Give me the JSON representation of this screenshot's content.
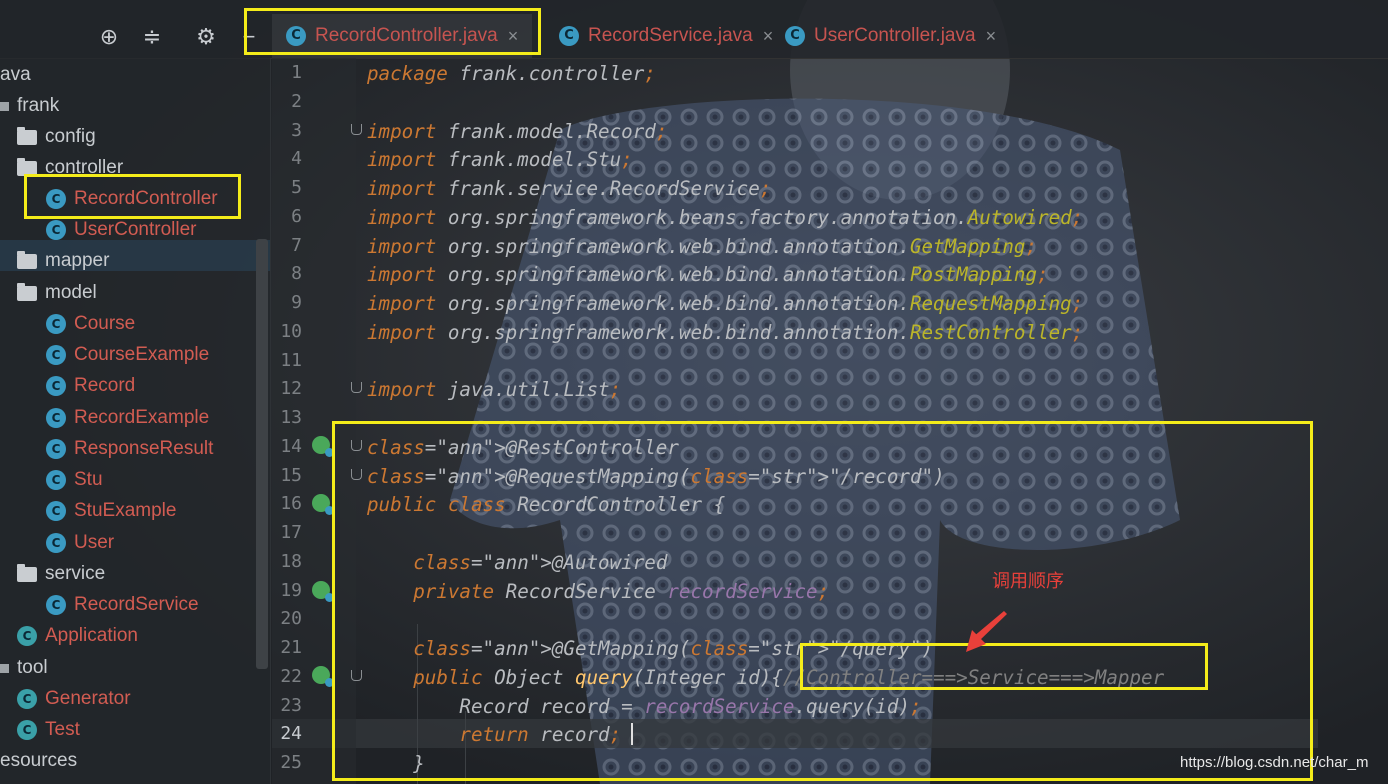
{
  "toolbar": {
    "icons": [
      "crosshair-icon",
      "collapse-icon",
      "gear-icon",
      "minimize-icon"
    ]
  },
  "tabs": [
    {
      "label": "RecordController.java",
      "icon": "class-icon",
      "active": true,
      "close": "×"
    },
    {
      "label": "RecordService.java",
      "icon": "class-icon",
      "active": false,
      "close": "×"
    },
    {
      "label": "UserController.java",
      "icon": "class-icon",
      "active": false,
      "close": "×"
    }
  ],
  "tree": {
    "items": [
      {
        "label": "ava",
        "kind": "root"
      },
      {
        "label": "frank",
        "kind": "package"
      },
      {
        "label": "config",
        "kind": "folder"
      },
      {
        "label": "controller",
        "kind": "folder"
      },
      {
        "label": "RecordController",
        "kind": "class",
        "selected": true
      },
      {
        "label": "UserController",
        "kind": "class"
      },
      {
        "label": "mapper",
        "kind": "folder"
      },
      {
        "label": "model",
        "kind": "folder"
      },
      {
        "label": "Course",
        "kind": "class"
      },
      {
        "label": "CourseExample",
        "kind": "class"
      },
      {
        "label": "Record",
        "kind": "class"
      },
      {
        "label": "RecordExample",
        "kind": "class"
      },
      {
        "label": "ResponseResult",
        "kind": "class"
      },
      {
        "label": "Stu",
        "kind": "class"
      },
      {
        "label": "StuExample",
        "kind": "class"
      },
      {
        "label": "User",
        "kind": "class"
      },
      {
        "label": "service",
        "kind": "folder"
      },
      {
        "label": "RecordService",
        "kind": "class"
      },
      {
        "label": "Application",
        "kind": "runclass"
      },
      {
        "label": "tool",
        "kind": "package"
      },
      {
        "label": "Generator",
        "kind": "runclass"
      },
      {
        "label": "Test",
        "kind": "runclass"
      },
      {
        "label": "esources",
        "kind": "root"
      }
    ]
  },
  "editor": {
    "current_line": "24",
    "lines": [
      {
        "n": "1",
        "t": "package frank.controller;"
      },
      {
        "n": "2",
        "t": ""
      },
      {
        "n": "3",
        "t": "import frank.model.Record;"
      },
      {
        "n": "4",
        "t": "import frank.model.Stu;"
      },
      {
        "n": "5",
        "t": "import frank.service.RecordService;"
      },
      {
        "n": "6",
        "t": "import org.springframework.beans.factory.annotation.Autowired;"
      },
      {
        "n": "7",
        "t": "import org.springframework.web.bind.annotation.GetMapping;"
      },
      {
        "n": "8",
        "t": "import org.springframework.web.bind.annotation.PostMapping;"
      },
      {
        "n": "9",
        "t": "import org.springframework.web.bind.annotation.RequestMapping;"
      },
      {
        "n": "10",
        "t": "import org.springframework.web.bind.annotation.RestController;"
      },
      {
        "n": "11",
        "t": ""
      },
      {
        "n": "12",
        "t": "import java.util.List;"
      },
      {
        "n": "13",
        "t": ""
      },
      {
        "n": "14",
        "t": "@RestController"
      },
      {
        "n": "15",
        "t": "@RequestMapping(\"/record\")"
      },
      {
        "n": "16",
        "t": "public class RecordController {"
      },
      {
        "n": "17",
        "t": ""
      },
      {
        "n": "18",
        "t": "    @Autowired"
      },
      {
        "n": "19",
        "t": "    private RecordService recordService;"
      },
      {
        "n": "20",
        "t": ""
      },
      {
        "n": "21",
        "t": "    @GetMapping(\"/query\")"
      },
      {
        "n": "22",
        "t": "    public Object query(Integer id){//Controller===>Service===>Mapper"
      },
      {
        "n": "23",
        "t": "        Record record = recordService.query(id);"
      },
      {
        "n": "24",
        "t": "        return record;"
      },
      {
        "n": "25",
        "t": "    }"
      }
    ]
  },
  "annotation_note": "调用顺序",
  "watermark": "https://blog.csdn.net/char_m",
  "colors": {
    "highlight": "#f4ec1a",
    "keyword": "#cc7832",
    "annotation": "#bbb529",
    "string": "#6a8759",
    "field": "#9876aa",
    "class_label": "#d25c52",
    "note": "#e8403a"
  }
}
